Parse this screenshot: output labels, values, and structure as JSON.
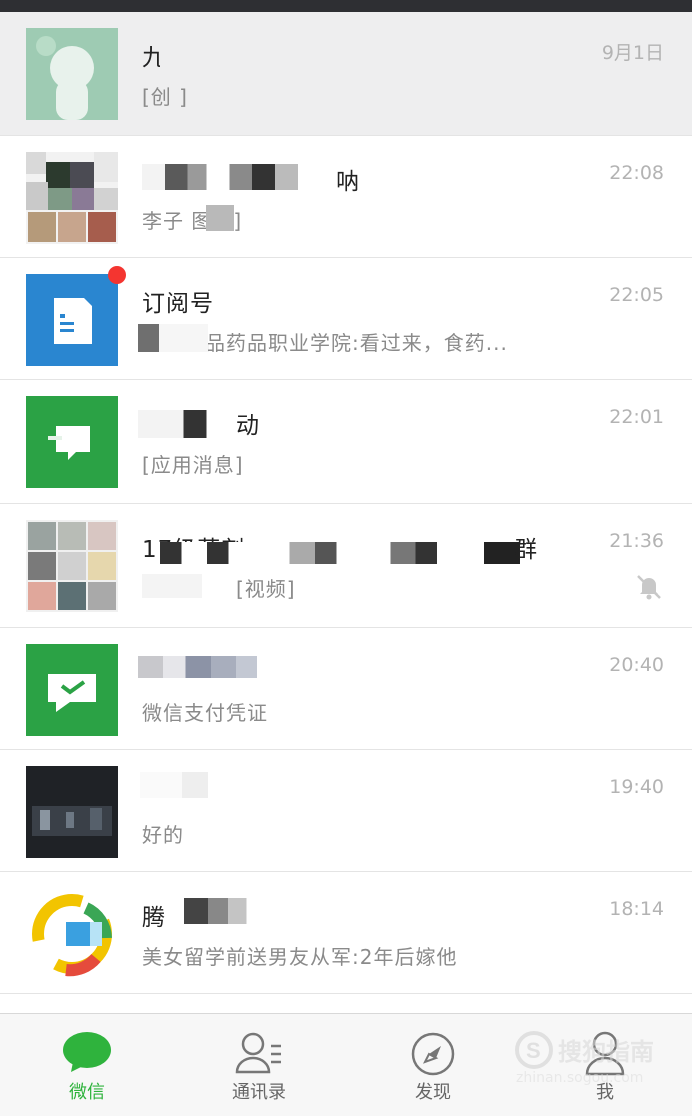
{
  "chats": [
    {
      "name": "九",
      "preview": "[创   ]",
      "time": "9月1日"
    },
    {
      "name": "呐",
      "preview": "李子    图片]",
      "time": "22:08"
    },
    {
      "name": "订阅号",
      "preview": "湖南食品药品职业学院:看过来，食药...",
      "time": "22:05"
    },
    {
      "name": "动",
      "preview": "[应用消息]",
      "time": "22:01"
    },
    {
      "name": "17级药剂",
      "name_suffix": "群",
      "preview": "[视频]",
      "time": "21:36",
      "muted": true
    },
    {
      "name": "",
      "preview": "微信支付凭证",
      "time": "20:40"
    },
    {
      "name": "",
      "preview": "好的",
      "time": "19:40"
    },
    {
      "name": "腾",
      "preview": "美女留学前送男友从军:2年后嫁他",
      "time": "18:14"
    }
  ],
  "tabbar": [
    {
      "label": "微信",
      "icon": "chat-bubble-icon",
      "active": true
    },
    {
      "label": "通讯录",
      "icon": "contacts-icon",
      "active": false
    },
    {
      "label": "发现",
      "icon": "compass-icon",
      "active": false
    },
    {
      "label": "我",
      "icon": "person-icon",
      "active": false
    }
  ],
  "watermark": {
    "text": "搜狗指南",
    "url": "zhinan.sogou.com"
  },
  "colors": {
    "accent": "#2fb33d",
    "badge": "#f43530",
    "pinned_bg": "#eeeeef"
  }
}
